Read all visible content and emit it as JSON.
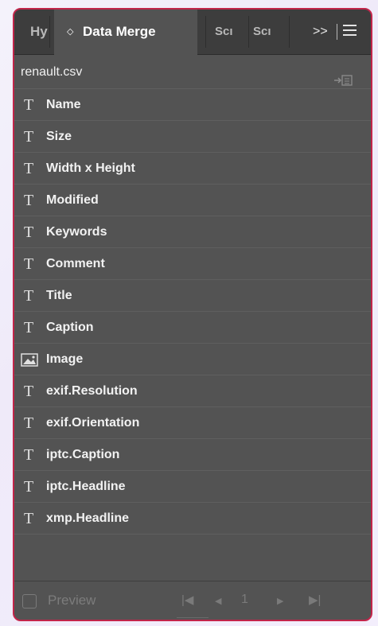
{
  "panel": {
    "tabs": [
      {
        "label": "Hy"
      },
      {
        "label": "Data Merge"
      },
      {
        "label": "Scı"
      },
      {
        "label": "Scı"
      }
    ],
    "overflow_label": ">>",
    "accent_color": "#c2254a"
  },
  "source": {
    "filename": "renault.csv",
    "icon": "import-data-icon"
  },
  "fields": [
    {
      "label": "Name",
      "type": "text"
    },
    {
      "label": "Size",
      "type": "text"
    },
    {
      "label": "Width x Height",
      "type": "text"
    },
    {
      "label": "Modified",
      "type": "text"
    },
    {
      "label": "Keywords",
      "type": "text"
    },
    {
      "label": "Comment",
      "type": "text"
    },
    {
      "label": "Title",
      "type": "text"
    },
    {
      "label": "Caption",
      "type": "text"
    },
    {
      "label": "Image",
      "type": "image"
    },
    {
      "label": "exif.Resolution",
      "type": "text"
    },
    {
      "label": "exif.Orientation",
      "type": "text"
    },
    {
      "label": "iptc.Caption",
      "type": "text"
    },
    {
      "label": "iptc.Headline",
      "type": "text"
    },
    {
      "label": "xmp.Headline",
      "type": "text"
    }
  ],
  "text_glyph": "T",
  "footer": {
    "preview_label": "Preview",
    "preview_checked": false,
    "first_glyph": "|◀",
    "prev_glyph": "◀",
    "page_number": "1",
    "next_glyph": "▶",
    "last_glyph": "▶|"
  }
}
